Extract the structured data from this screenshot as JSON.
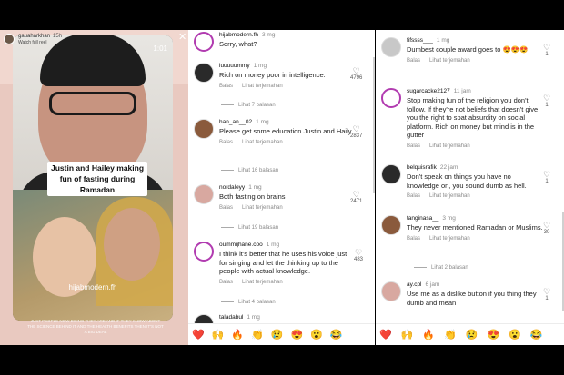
{
  "story": {
    "username": "gauaharkhan",
    "age": "15h",
    "subtitle": "Watch full reel",
    "video_time": "1:01",
    "caption": "Justin and Hailey making fun of fasting during Ramadan",
    "handle": "hijabmodern.fh",
    "fine_print": "JUST PEOPLE NOW DOING THEY ARE AND IF THEY KNOW ABOUT THE SCIENCE BEHIND IT AND THE HEALTH BENEFITS THEN IT'S NOT A BIG DEAL"
  },
  "panel_left": {
    "comments": [
      {
        "user": "hijabmodern.fh",
        "time": "3 mg",
        "text": "Sorry, what?"
      },
      {
        "user": "luuuuummy",
        "time": "1 mg",
        "text": "Rich on money poor in intelligence.",
        "reply": "Balas",
        "translate": "Lihat terjemahan",
        "likes": "4796",
        "replies": "Lihat 7 balasan"
      },
      {
        "user": "han_an__02",
        "time": "1 mg",
        "text": "Please get some education Justin and Haily.",
        "reply": "Balas",
        "translate": "Lihat terjemahan",
        "likes": "2837",
        "replies": "Lihat 16 balasan"
      },
      {
        "user": "nordaleyy",
        "time": "1 mg",
        "text": "Both fasting on brains",
        "reply": "Balas",
        "translate": "Lihat terjemahan",
        "likes": "2471",
        "replies": "Lihat 19 balasan"
      },
      {
        "user": "oummijhane.coo",
        "time": "1 mg",
        "text": "I think it's better that he uses his voice just for singing and let the thinking up to the people with actual knowledge.",
        "reply": "Balas",
        "translate": "Lihat terjemahan",
        "likes": "483",
        "replies": "Lihat 4 balasan"
      },
      {
        "user": "taladabul",
        "time": "1 mg"
      }
    ],
    "emojis": [
      "❤️",
      "🙌",
      "🔥",
      "👏",
      "😢",
      "😍",
      "😮",
      "😂"
    ]
  },
  "panel_right": {
    "comments": [
      {
        "user": "fifssss___",
        "time": "1 mg",
        "text": "Dumbest couple award goes to 😍😍😍",
        "reply": "Balas",
        "translate": "Lihat terjemahan",
        "likes": "1"
      },
      {
        "user": "sugarcacke2127",
        "time": "11 jam",
        "text": "Stop making fun of the religion you don't follow. If they're not beliefs that doesn't give you the right to spat absurdity on social platform. Rich on money but mind is in the gutter",
        "reply": "Balas",
        "translate": "Lihat terjemahan",
        "likes": "1"
      },
      {
        "user": "belquisrafik",
        "time": "22 jam",
        "text": "Don't speak on things you have no knowledge on, you sound dumb as hell.",
        "reply": "Balas",
        "translate": "Lihat terjemahan",
        "likes": "1"
      },
      {
        "user": "tanginasa__",
        "time": "3 mg",
        "text": "They never mentioned Ramadan or Muslims.",
        "reply": "Balas",
        "translate": "Lihat terjemahan",
        "likes": "30",
        "replies": "Lihat 2 balasan"
      },
      {
        "user": "ay.cpl",
        "time": "6 jam",
        "text": "Use me as a dislike button if you thing they dumb and mean",
        "likes": "1"
      }
    ],
    "emojis": [
      "❤️",
      "🙌",
      "🔥",
      "👏",
      "😢",
      "😍",
      "😮",
      "😂"
    ]
  }
}
